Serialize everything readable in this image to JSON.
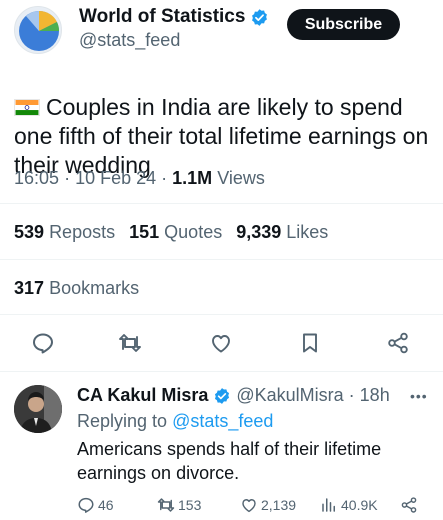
{
  "post": {
    "author_name": "World of Statistics",
    "author_handle": "@stats_feed",
    "subscribe_label": "Subscribe",
    "text": "Couples in India are likely to spend one fifth of their total lifetime earnings on their wedding",
    "time": "16:05",
    "date": "10 Feb 24",
    "views_count": "1.1M",
    "views_label": "Views",
    "reposts_count": "539",
    "reposts_label": "Reposts",
    "quotes_count": "151",
    "quotes_label": "Quotes",
    "likes_count": "9,339",
    "likes_label": "Likes",
    "bookmarks_count": "317",
    "bookmarks_label": "Bookmarks"
  },
  "reply": {
    "author_name": "CA Kakul Misra",
    "author_handle": "@KakulMisra",
    "age": "18h",
    "replying_prefix": "Replying to",
    "replying_to": "@stats_feed",
    "text": "Americans spends half of their lifetime earnings on divorce.",
    "replies": "46",
    "reposts": "153",
    "likes": "2,139",
    "views": "40.9K"
  },
  "colors": {
    "accent": "#1d9bf0",
    "text": "#0f1419",
    "muted": "#536471",
    "verified": "#1d9bf0"
  },
  "icons": [
    "verified-badge-icon",
    "india-flag-icon",
    "reply-icon",
    "repost-icon",
    "like-icon",
    "bookmark-icon",
    "share-icon",
    "views-icon",
    "more-icon"
  ]
}
